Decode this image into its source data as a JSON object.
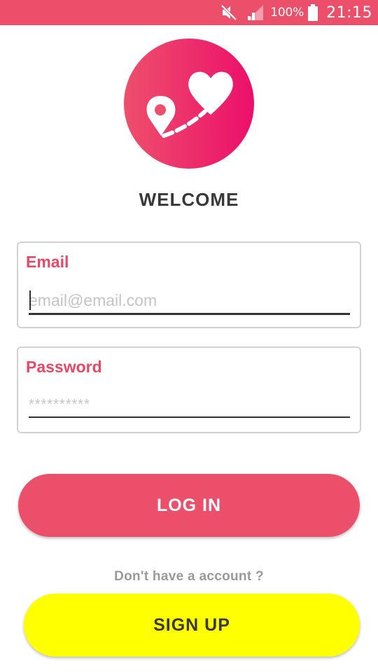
{
  "status_bar": {
    "battery_percent": "100%",
    "time": "21:15",
    "icons": [
      "mute-icon",
      "signal-icon",
      "battery-icon"
    ],
    "background_color": "#ec4f6a"
  },
  "logo": {
    "icons": [
      "map-pin-icon",
      "heart-icon"
    ],
    "gradient_colors": [
      "#ee4f6c",
      "#ec0f6b"
    ]
  },
  "welcome": {
    "title": "WELCOME"
  },
  "form": {
    "email": {
      "label": "Email",
      "placeholder": "email@email.com",
      "value": ""
    },
    "password": {
      "label": "Password",
      "placeholder": "**********",
      "value": ""
    }
  },
  "actions": {
    "login_label": "LOG IN",
    "signup_prompt": "Don't have a account ?",
    "signup_label": "SIGN UP"
  },
  "colors": {
    "accent": "#ec4f6a",
    "label": "#e84867",
    "signup": "#ffff00",
    "text_dark": "#383838",
    "muted": "#9a9a9a"
  }
}
